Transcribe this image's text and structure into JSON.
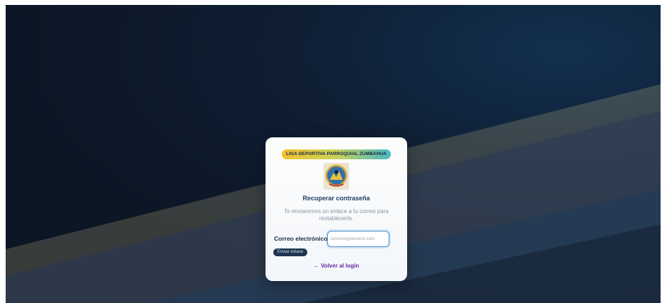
{
  "card": {
    "badge": "LIGA DEPORTIVA PARROQUIAL ZUMBAHUA",
    "title": "Recuperar contraseña",
    "subtitle": "Te enviaremos un enlace a tu correo para restablecerla.",
    "email_label": "Correo electrónico",
    "email_placeholder": "tucorreo@dominio.com",
    "email_value": "",
    "send_button": "Enviar enlace",
    "back_link": "← Volver al login"
  },
  "colors": {
    "background": "#0c1625",
    "card": "#f7f8fb",
    "title": "#1f3f66",
    "link": "#6a2aa3",
    "button": "#1f3550",
    "badge_start": "#f2c230",
    "badge_end": "#49b9c6"
  },
  "icons": {
    "logo": "league-crest-icon"
  }
}
